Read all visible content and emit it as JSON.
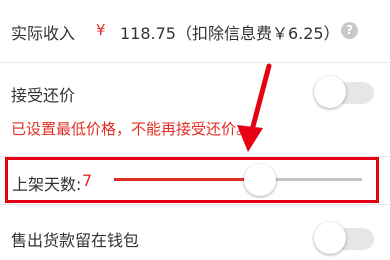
{
  "income": {
    "label": "实际收入",
    "currency": "¥",
    "amount": "118.75（扣除信息费￥6.25）",
    "help_icon": "help-circle-icon"
  },
  "accept_counter_offer": {
    "label": "接受还价",
    "toggle_on": false,
    "note": "已设置最低价格，不能再接受还价。"
  },
  "listing_days": {
    "label": "上架天数:",
    "value": "7",
    "slider_fraction": 0.59
  },
  "wallet": {
    "label": "售出货款留在钱包",
    "toggle_on": false
  },
  "colors": {
    "accent": "#e02e24",
    "highlight": "#e60012",
    "toggle_off": "#e6e6e6"
  }
}
